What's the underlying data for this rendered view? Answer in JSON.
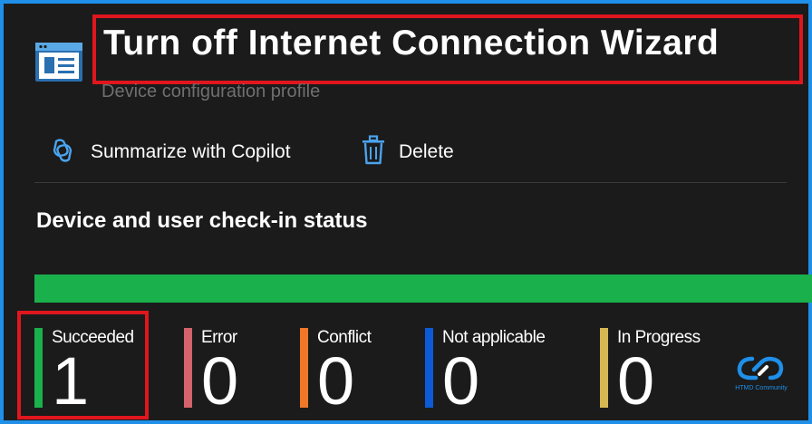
{
  "header": {
    "title": "Turn off Internet Connection Wizard",
    "subtitle": "Device configuration profile",
    "icon": "profile-window-icon"
  },
  "toolbar": {
    "summarize_label": "Summarize with Copilot",
    "summarize_icon": "copilot-icon",
    "delete_label": "Delete",
    "delete_icon": "trash-icon"
  },
  "section": {
    "title": "Device and user check-in status"
  },
  "progress": {
    "succeeded_fraction": 1.0,
    "color": "#1ab04c"
  },
  "stats": [
    {
      "label": "Succeeded",
      "count": "1",
      "color": "#1ab04c"
    },
    {
      "label": "Error",
      "count": "0",
      "color": "#d4636b"
    },
    {
      "label": "Conflict",
      "count": "0",
      "color": "#f07828"
    },
    {
      "label": "Not applicable",
      "count": "0",
      "color": "#0c5ad8"
    },
    {
      "label": "In Progress",
      "count": "0",
      "color": "#d6b852"
    }
  ],
  "watermark": {
    "text": "HTMD Community",
    "color": "#1f8fe8"
  }
}
